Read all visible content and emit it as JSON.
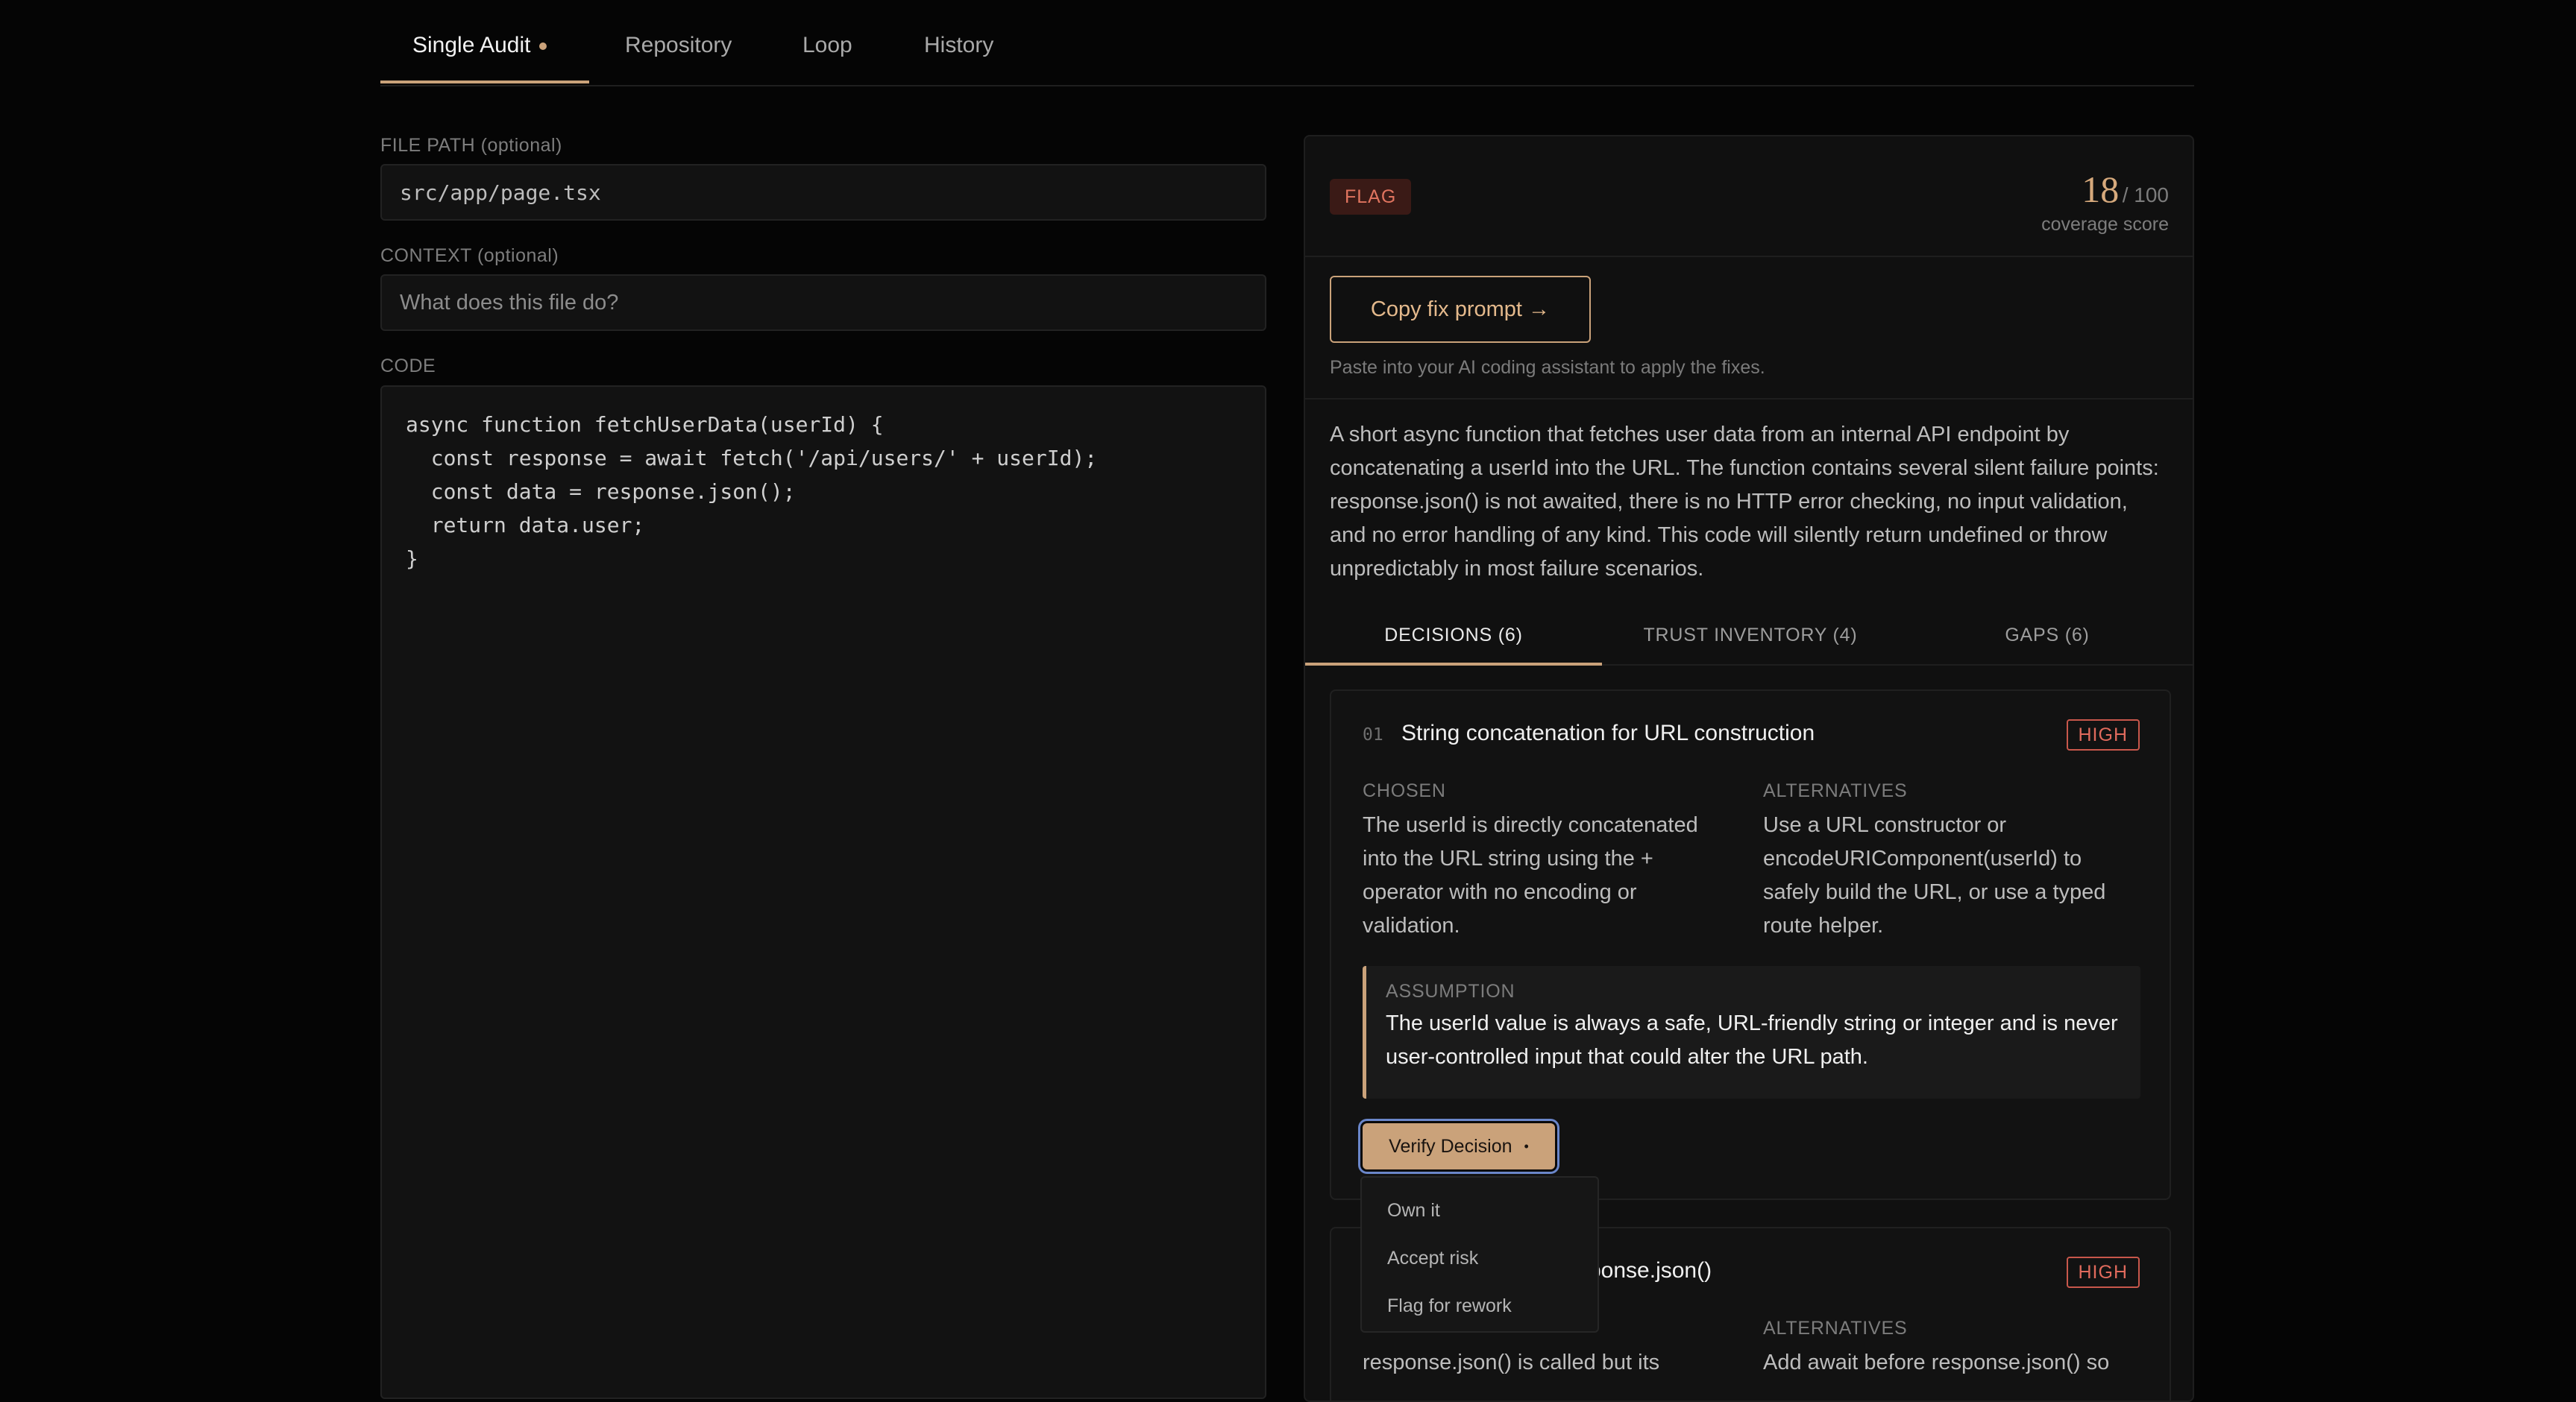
{
  "tabs": [
    {
      "label": "Single Audit",
      "active": true,
      "dot": true
    },
    {
      "label": "Repository"
    },
    {
      "label": "Loop"
    },
    {
      "label": "History"
    }
  ],
  "form": {
    "file_path_label": "FILE PATH (optional)",
    "file_path_value": "src/app/page.tsx",
    "context_label": "CONTEXT (optional)",
    "context_placeholder": "What does this file do?",
    "code_label": "CODE",
    "code": "async function fetchUserData(userId) {\n  const response = await fetch('/api/users/' + userId);\n  const data = response.json();\n  return data.user;\n}"
  },
  "result": {
    "flag": "FLAG",
    "score": "18",
    "score_max": "/ 100",
    "score_caption": "coverage score",
    "copy_button": "Copy fix prompt →",
    "copy_hint": "Paste into your AI coding assistant to apply the fixes.",
    "summary": "A short async function that fetches user data from an internal API endpoint by concatenating a userId into the URL. The function contains several silent failure points: response.json() is not awaited, there is no HTTP error checking, no input validation, and no error handling of any kind. This code will silently return undefined or throw unpredictably in most failure scenarios."
  },
  "subtabs": [
    {
      "label": "DECISIONS (6)",
      "active": true
    },
    {
      "label": "TRUST INVENTORY (4)"
    },
    {
      "label": "GAPS (6)"
    }
  ],
  "decisions": [
    {
      "num": "01",
      "title": "String concatenation for URL construction",
      "severity": "HIGH",
      "chosen_label": "CHOSEN",
      "chosen": "The userId is directly concatenated into the URL string using the + operator with no encoding or validation.",
      "alternatives_label": "ALTERNATIVES",
      "alternatives": "Use a URL constructor or encodeURIComponent(userId) to safely build the URL, or use a typed route helper.",
      "assumption_label": "ASSUMPTION",
      "assumption": "The userId value is always a safe, URL-friendly string or integer and is never user-controlled input that could alter the URL path.",
      "verify_label": "Verify Decision"
    },
    {
      "title_visible": "sponse.json()",
      "severity": "HIGH",
      "alternatives_label": "ALTERNATIVES",
      "chosen_visible": "response.json() is called but its",
      "alternatives_visible": "Add await before response.json() so"
    }
  ],
  "verify_menu": [
    "Own it",
    "Accept risk",
    "Flag for rework"
  ]
}
